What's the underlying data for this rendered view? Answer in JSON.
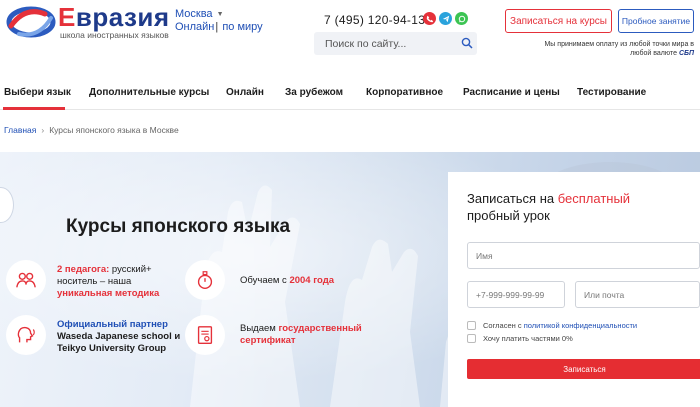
{
  "header": {
    "brand_first": "Е",
    "brand_rest": "вразия",
    "brand_sub": "школа иностранных языков",
    "city": "Москва",
    "mode_online": "Онлайн",
    "mode_world": "по миру",
    "phone": "7 (495) 120-94-13",
    "search_placeholder": "Поиск по сайту...",
    "enroll_label": "Записаться на курсы",
    "trial_label": "Пробное занятие",
    "pay_note": "Мы принимаем оплату из любой точки мира в любой валюте",
    "pay_logo": "СБП"
  },
  "nav": {
    "items": [
      "Выбери язык",
      "Дополнительные курсы",
      "Онлайн",
      "За рубежом",
      "Корпоративное",
      "Расписание и цены",
      "Тестирование"
    ]
  },
  "breadcrumb": {
    "home": "Главная",
    "current": "Курсы японского языка в Москве"
  },
  "hero": {
    "title": "Курсы японского языка",
    "features": {
      "teachers_red": "2 педагога:",
      "teachers_text": " русский+ носитель – наша ",
      "teachers_red2": "уникальная методика",
      "year_text": "Обучаем с ",
      "year_red": "2004 года",
      "partner_blue": "Официальный партнер",
      "partner_text": "Waseda Japanese school и Teikyo University Group",
      "cert_text": "Выдаем ",
      "cert_red": "государственный сертификат"
    }
  },
  "form": {
    "title_a": "Записаться на ",
    "title_red": "бесплатный",
    "title_b": "пробный урок",
    "name_placeholder": "Имя",
    "phone_placeholder": "+7-999-999-99-99",
    "email_placeholder": "Или почта",
    "agree_text": "Согласен с ",
    "agree_link": "политикой конфиденциальности",
    "installments": "Хочу платить частями 0%",
    "submit": "Записаться"
  },
  "colors": {
    "accent_red": "#e5313a",
    "brand_blue": "#1e3a8a",
    "link_blue": "#1f4fb5"
  }
}
